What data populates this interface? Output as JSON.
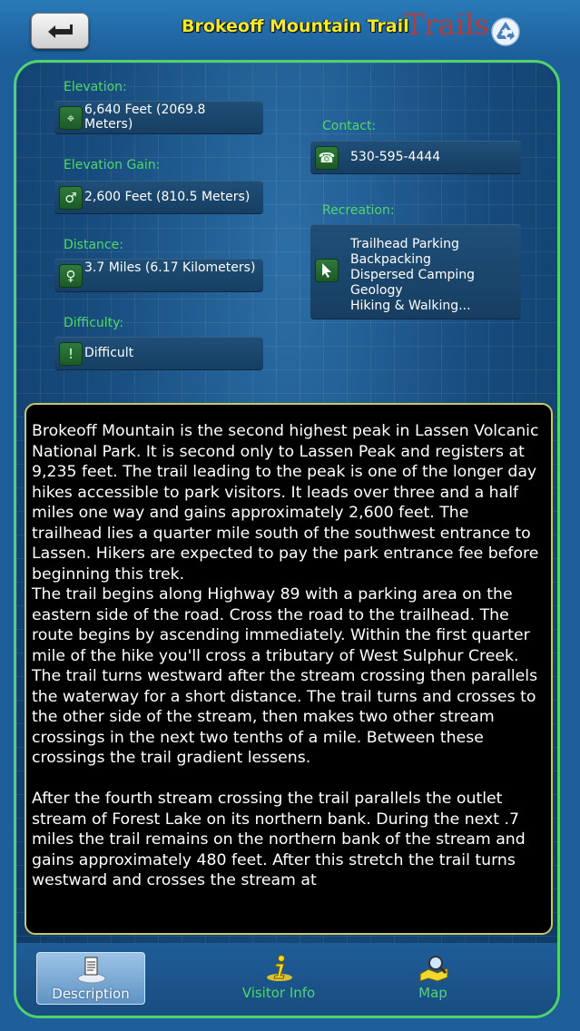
{
  "header": {
    "title": "Brokeoff Mountain Trail",
    "logo_text": "Trails",
    "back_icon": "back-arrow-icon",
    "recycle_icon": "recycle-icon"
  },
  "info": {
    "elevation": {
      "label": "Elevation:",
      "value": "6,640 Feet (2069.8 Meters)",
      "icon": "crosshair-icon"
    },
    "elevation_gain": {
      "label": "Elevation  Gain:",
      "value": "2,600 Feet (810.5 Meters)",
      "icon": "male-symbol-icon"
    },
    "distance": {
      "label": "Distance:",
      "value": "3.7 Miles (6.17 Kilometers)",
      "icon": "female-symbol-icon"
    },
    "difficulty": {
      "label": "Difficulty:",
      "value": "Difficult",
      "icon": "exclamation-icon"
    },
    "contact": {
      "label": "Contact:",
      "value": "530-595-4444",
      "icon": "phone-icon"
    },
    "recreation": {
      "label": "Recreation:",
      "icon": "pointer-icon",
      "items": [
        "Trailhead Parking",
        "Backpacking",
        "Dispersed Camping",
        "Geology",
        "Hiking & Walking..."
      ]
    }
  },
  "description": {
    "text": "Brokeoff Mountain is the second highest peak in Lassen Volcanic National Park. It is second only to Lassen Peak and registers at 9,235 feet. The trail leading to the peak is one of the longer day hikes accessible to park visitors. It leads over three and a half miles one way and gains approximately 2,600 feet. The trailhead lies a quarter mile south of the southwest entrance to Lassen. Hikers are expected to pay the park entrance fee before beginning this trek.\nThe trail begins along Highway 89 with a parking area on the eastern side of the road. Cross the road to the trailhead. The route begins by ascending immediately. Within the first quarter mile of the hike you'll cross a tributary of West Sulphur Creek. The trail turns westward after the stream crossing then parallels the waterway for a short distance. The trail turns and crosses to the other side of the stream, then makes two other stream crossings in the next two tenths of a mile. Between these crossings the trail gradient lessens.\n\nAfter the fourth stream crossing the trail parallels the outlet stream of Forest Lake on its northern bank. During the next .7 miles the trail remains on the northern bank of the stream and gains approximately 480 feet. After this stretch the trail turns westward and crosses the stream at"
  },
  "tabs": [
    {
      "label": "Description",
      "icon": "document-icon",
      "selected": true
    },
    {
      "label": "Visitor Info",
      "icon": "info-icon",
      "selected": false
    },
    {
      "label": "Map",
      "icon": "map-magnifier-icon",
      "selected": false
    }
  ],
  "colors": {
    "accent_green": "#52d76a",
    "title_yellow": "#f6e92a",
    "panel_border": "#4fd36a"
  }
}
